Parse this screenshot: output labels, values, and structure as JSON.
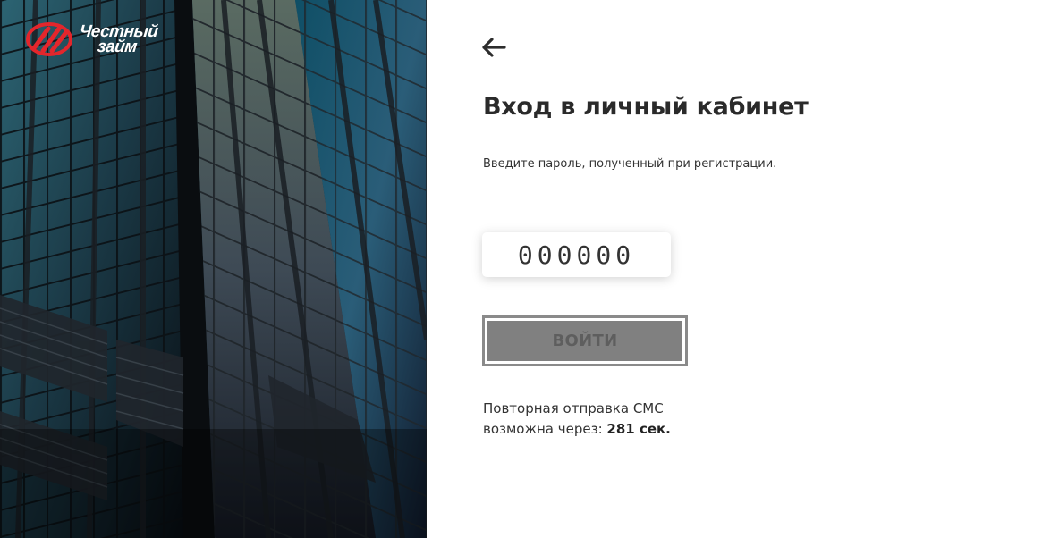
{
  "logo": {
    "line1": "Честный",
    "line2": "займ",
    "icon": "brand-logo-icon",
    "brand_color": "#e3262c"
  },
  "back": {
    "icon": "arrow-left-icon"
  },
  "title": "Вход в личный кабинет",
  "subtitle": "Введите пароль, полученный при регистрации.",
  "code_input": {
    "placeholder": "000000",
    "value": ""
  },
  "login_button": {
    "label": "ВОЙТИ",
    "disabled": true
  },
  "resend": {
    "line1": "Повторная отправка СМС",
    "line2_prefix": "возможна через: ",
    "countdown": "281 сек."
  },
  "hero": {
    "image": "skyscraper-glass-facade"
  }
}
